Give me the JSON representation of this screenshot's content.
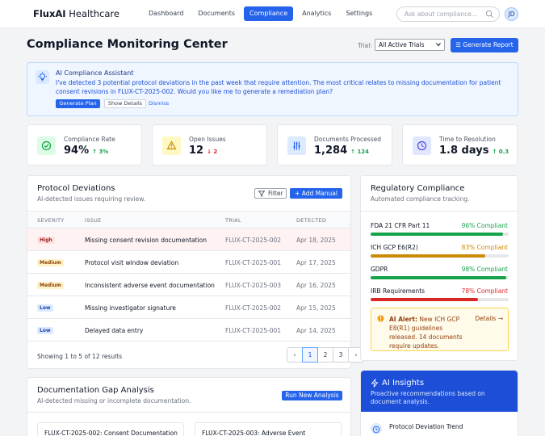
{
  "brand": {
    "bold": "FluxAI",
    "rest": " Healthcare"
  },
  "nav": [
    "Dashboard",
    "Documents",
    "Compliance",
    "Analytics",
    "Settings"
  ],
  "search": {
    "placeholder": "Ask about compliance..."
  },
  "user": {
    "initials": "JD"
  },
  "page": {
    "title": "Compliance Monitoring Center"
  },
  "trial_filter": {
    "label": "Trial:",
    "selected": "All Active Trials"
  },
  "generate_report": "Generate Report",
  "assistant": {
    "title": "AI Compliance Assistant",
    "message": "I've detected 3 potential protocol deviations in the past week that require attention. The most critical relates to missing documentation for patient consent revisions in FLUX-CT-2025-002. Would you like me to generate a remediation plan?",
    "buttons": {
      "generate_plan": "Generate Plan",
      "show_details": "Show Details",
      "dismiss": "Dismiss"
    }
  },
  "stats": [
    {
      "label": "Compliance Rate",
      "value": "94%",
      "delta": "3%",
      "direction": "up",
      "icon": "check-circle-icon",
      "color": "#16a34a",
      "bg": "#dcfce7"
    },
    {
      "label": "Open Issues",
      "value": "12",
      "delta": "2",
      "direction": "down",
      "icon": "warning-icon",
      "color": "#ca8a04",
      "bg": "#fef9c3"
    },
    {
      "label": "Documents Processed",
      "value": "1,284",
      "delta": "124",
      "direction": "up",
      "icon": "sliders-icon",
      "color": "#2563eb",
      "bg": "#dbeafe"
    },
    {
      "label": "Time to Resolution",
      "value": "1.8 days",
      "delta": "0.3",
      "direction": "up",
      "icon": "clock-icon",
      "color": "#4f46e5",
      "bg": "#e0e7ff"
    }
  ],
  "deviations": {
    "title": "Protocol Deviations",
    "subtitle": "AI-detected issues requiring review.",
    "filter": "Filter",
    "add_manual": "+ Add Manual",
    "columns": [
      "SEVERITY",
      "ISSUE",
      "TRIAL",
      "DETECTED"
    ],
    "rows": [
      {
        "severity": "High",
        "issue": "Missing consent revision documentation",
        "trial": "FLUX-CT-2025-002",
        "detected": "Apr 18, 2025"
      },
      {
        "severity": "Medium",
        "issue": "Protocol visit window deviation",
        "trial": "FLUX-CT-2025-001",
        "detected": "Apr 17, 2025"
      },
      {
        "severity": "Medium",
        "issue": "Inconsistent adverse event documentation",
        "trial": "FLUX-CT-2025-003",
        "detected": "Apr 16, 2025"
      },
      {
        "severity": "Low",
        "issue": "Missing investigator signature",
        "trial": "FLUX-CT-2025-002",
        "detected": "Apr 15, 2025"
      },
      {
        "severity": "Low",
        "issue": "Delayed data entry",
        "trial": "FLUX-CT-2025-001",
        "detected": "Apr 14, 2025"
      }
    ],
    "pagination": {
      "text": "Showing 1 to 5 of 12 results",
      "pages": [
        "1",
        "2",
        "3"
      ],
      "active": "1"
    }
  },
  "regulatory": {
    "title": "Regulatory Compliance",
    "subtitle": "Automated compliance tracking.",
    "items": [
      {
        "name": "FDA 21 CFR Part 11",
        "status": "96% Compliant",
        "percent": 96,
        "color": "#16a34a"
      },
      {
        "name": "ICH GCP E6(R2)",
        "status": "83% Compliant",
        "percent": 83,
        "color": "#ca8a04"
      },
      {
        "name": "GDPR",
        "status": "98% Compliant",
        "percent": 98,
        "color": "#16a34a"
      },
      {
        "name": "IRB Requirements",
        "status": "78% Compliant",
        "percent": 78,
        "color": "#dc2626"
      }
    ],
    "alert": {
      "label": "AI Alert:",
      "text": " New ICH GCP E8(R1) guidelines released. 14 documents require updates.",
      "link": "Details →"
    }
  },
  "gap_analysis": {
    "title": "Documentation Gap Analysis",
    "subtitle": "AI-detected missing or incomplete documentation.",
    "run": "Run New Analysis",
    "cards": [
      "FLUX-CT-2025-002: Consent Documentation",
      "FLUX-CT-2025-003: Adverse Event"
    ]
  },
  "insights": {
    "title": "AI Insights",
    "subtitle": "Proactive recommendations based on document analysis.",
    "first": "Protocol Deviation Trend"
  }
}
